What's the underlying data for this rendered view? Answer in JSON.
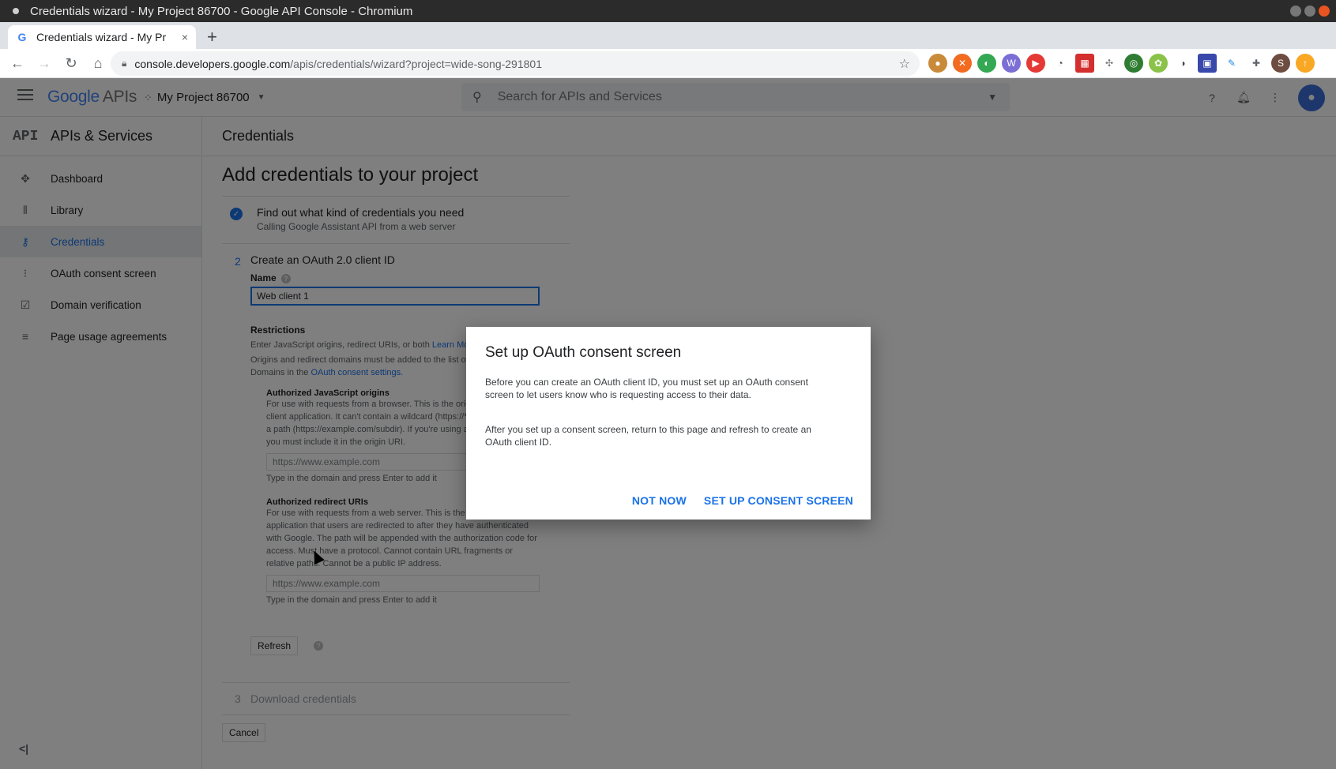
{
  "os": {
    "window_title": "Credentials wizard - My Project 86700 - Google API Console - Chromium"
  },
  "browser": {
    "tab_title": "Credentials wizard - My Pr",
    "tab_close": "×",
    "new_tab": "+",
    "url_host": "console.developers.google.com",
    "url_path": "/apis/credentials/wizard?project=wide-song-291801",
    "profile_initial": "S"
  },
  "header": {
    "logo_google": "Google",
    "logo_apis": "APIs",
    "project_name": "My Project 86700",
    "search_placeholder": "Search for APIs and Services"
  },
  "sidebar": {
    "mark": "API",
    "title": "APIs & Services",
    "items": [
      {
        "label": "Dashboard",
        "icon": "dashboard-icon"
      },
      {
        "label": "Library",
        "icon": "library-icon"
      },
      {
        "label": "Credentials",
        "icon": "key-icon"
      },
      {
        "label": "OAuth consent screen",
        "icon": "consent-icon"
      },
      {
        "label": "Domain verification",
        "icon": "checkbox-icon"
      },
      {
        "label": "Page usage agreements",
        "icon": "settings-list-icon"
      }
    ]
  },
  "main": {
    "header": "Credentials",
    "heading": "Add credentials to your project",
    "step1": {
      "title": "Find out what kind of credentials you need",
      "subtitle": "Calling Google Assistant API from a web server"
    },
    "step2": {
      "num": "2",
      "title": "Create an OAuth 2.0 client ID",
      "name_label": "Name",
      "name_value": "Web client 1",
      "restrictions_title": "Restrictions",
      "restrictions_line1": "Enter JavaScript origins, redirect URIs, or both",
      "learn_more": "Learn More",
      "restrictions_line2": "Origins and redirect domains must be added to the list of Authorized",
      "restrictions_line3_prefix": "Domains in the",
      "oauth_settings_link": "OAuth consent settings.",
      "js_title": "Authorized JavaScript origins",
      "js_desc": "For use with requests from a browser. This is the origin URI of the client application. It can't contain a wildcard (https://*.example.com) or a path (https://example.com/subdir). If you're using a nonstandard port, you must include it in the origin URI.",
      "js_placeholder": "https://www.example.com",
      "js_hint": "Type in the domain and press Enter to add it",
      "redirect_title": "Authorized redirect URIs",
      "redirect_desc": "For use with requests from a web server. This is the path in your application that users are redirected to after they have authenticated with Google. The path will be appended with the authorization code for access. Must have a protocol. Cannot contain URL fragments or relative paths. Cannot be a public IP address.",
      "redirect_placeholder": "https://www.example.com",
      "redirect_hint": "Type in the domain and press Enter to add it",
      "refresh_label": "Refresh"
    },
    "step3": {
      "num": "3",
      "title": "Download credentials"
    },
    "cancel_label": "Cancel"
  },
  "dialog": {
    "title": "Set up OAuth consent screen",
    "para1": "Before you can create an OAuth client ID, you must set up an OAuth consent screen to let users know who is requesting access to their data.",
    "para2": "After you set up a consent screen, return to this page and refresh to create an OAuth client ID.",
    "not_now": "NOT NOW",
    "setup": "SET UP CONSENT SCREEN"
  }
}
